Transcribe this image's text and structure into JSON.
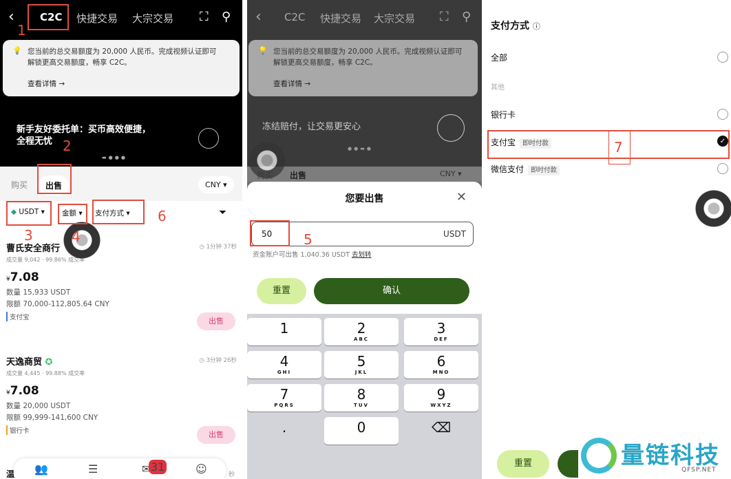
{
  "p1": {
    "tabs": [
      "C2C",
      "快捷交易",
      "大宗交易"
    ],
    "back": "‹",
    "scan_icon": "scan-icon",
    "search_icon": "search-icon",
    "notice_line1": "您当前的总交易额度为 20,000 人民币。完成视频认证即可",
    "notice_line2": "解锁更高交易额度，畅享 C2C。",
    "notice_more": "查看详情 →",
    "banner_line1": "新手友好委托单：买币高效便捷，",
    "banner_line2": "全程无忧",
    "buy": "购买",
    "sell": "出售",
    "currency": "CNY ▾",
    "coin": "USDT ▾",
    "amount": "金额 ▾",
    "payment": "支付方式 ▾",
    "merchants": [
      {
        "name": "曹氏安全商行",
        "stat": "成交量 9,042 · 99.86% 成交率",
        "time": "1分钟 37秒",
        "price": "7.08",
        "qty": "数量 15,933 USDT",
        "limit": "限额 70,000-112,805.64 CNY",
        "pay": "支付宝",
        "sell": "出售"
      },
      {
        "name": "天逸商贸",
        "stat": "成交量 4,445 · 99.88% 成交率",
        "time": "3分钟 26秒",
        "price": "7.08",
        "qty": "数量 20,000 USDT",
        "limit": "限额 99,999-141,600 CNY",
        "pay": "银行卡",
        "sell": "出售"
      }
    ],
    "third_merchant_fragment": "温",
    "third_time_fragment": "秒",
    "badge": "31"
  },
  "p2": {
    "banner": "冻结赔付，让交易更安心",
    "sheet_title": "您要出售",
    "amount_value": "50",
    "amount_unit": "USDT",
    "avail": "资金账户可出售 1,040.36 USDT",
    "transfer": "去划转",
    "reset": "重置",
    "confirm": "确认",
    "keys": [
      {
        "n": "1",
        "s": ""
      },
      {
        "n": "2",
        "s": "ABC"
      },
      {
        "n": "3",
        "s": "DEF"
      },
      {
        "n": "4",
        "s": "GHI"
      },
      {
        "n": "5",
        "s": "JKL"
      },
      {
        "n": "6",
        "s": "MNO"
      },
      {
        "n": "7",
        "s": "PQRS"
      },
      {
        "n": "8",
        "s": "TUV"
      },
      {
        "n": "9",
        "s": "WXYZ"
      },
      {
        "n": ".",
        "s": ""
      },
      {
        "n": "0",
        "s": ""
      },
      {
        "n": "⌫",
        "s": ""
      }
    ]
  },
  "p3": {
    "title": "支付方式",
    "info": "ⓘ",
    "all": "全部",
    "other": "其他",
    "bank": "银行卡",
    "alipay": "支付宝",
    "alipay_tag": "即时付款",
    "wechat": "微信支付",
    "wechat_tag": "即时付款",
    "check": "✓",
    "reset": "重置"
  },
  "annotations": [
    "1",
    "2",
    "3",
    "4",
    "5",
    "6",
    "7"
  ],
  "watermark": {
    "text": "量链科技",
    "sub": "QFSP.NET"
  },
  "colors": {
    "annotation": "#e24c3c",
    "confirm": "#2f5e1a",
    "reset": "#d6f0a0",
    "sell_pill": "#fbd8e6"
  }
}
